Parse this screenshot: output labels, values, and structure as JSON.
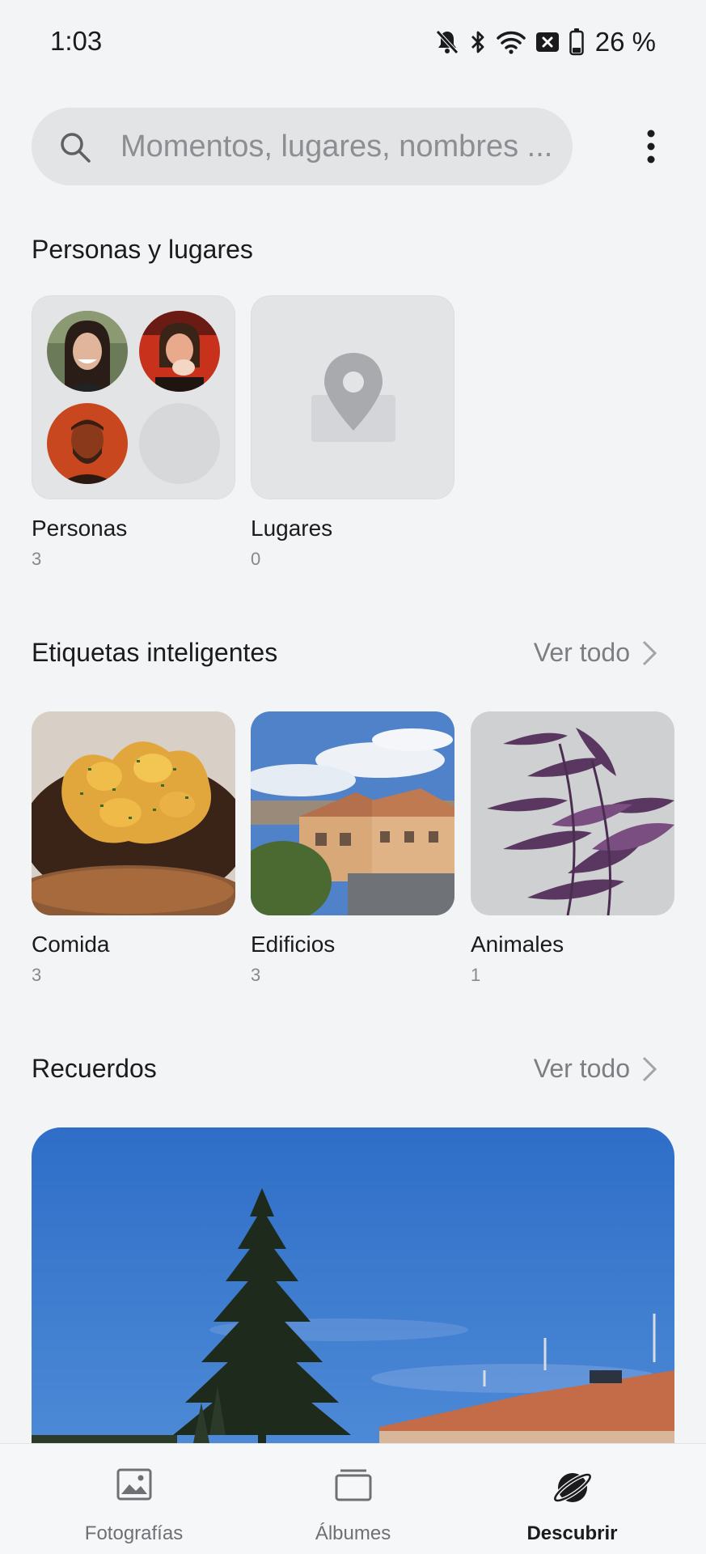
{
  "status_bar": {
    "time": "1:03",
    "battery": "26 %",
    "icons": [
      "mute-icon",
      "bluetooth-icon",
      "wifi-icon",
      "no-sim-icon",
      "battery-icon"
    ]
  },
  "search": {
    "placeholder": "Momentos, lugares, nombres ..."
  },
  "sections": {
    "people_places": {
      "title": "Personas y lugares",
      "items": [
        {
          "label": "Personas",
          "count": "3"
        },
        {
          "label": "Lugares",
          "count": "0"
        }
      ]
    },
    "smart_tags": {
      "title": "Etiquetas inteligentes",
      "see_all": "Ver todo",
      "items": [
        {
          "label": "Comida",
          "count": "3"
        },
        {
          "label": "Edificios",
          "count": "3"
        },
        {
          "label": "Animales",
          "count": "1"
        }
      ]
    },
    "memories": {
      "title": "Recuerdos",
      "see_all": "Ver todo"
    }
  },
  "bottom_nav": {
    "items": [
      {
        "label": "Fotografías",
        "icon": "photo-icon",
        "active": false
      },
      {
        "label": "Álbumes",
        "icon": "albums-icon",
        "active": false
      },
      {
        "label": "Descubrir",
        "icon": "discover-icon",
        "active": true
      }
    ]
  },
  "colors": {
    "background": "#f3f4f6",
    "search_bg": "#e3e4e6",
    "text_primary": "#1b1b1d",
    "text_secondary": "#7c7e82"
  }
}
